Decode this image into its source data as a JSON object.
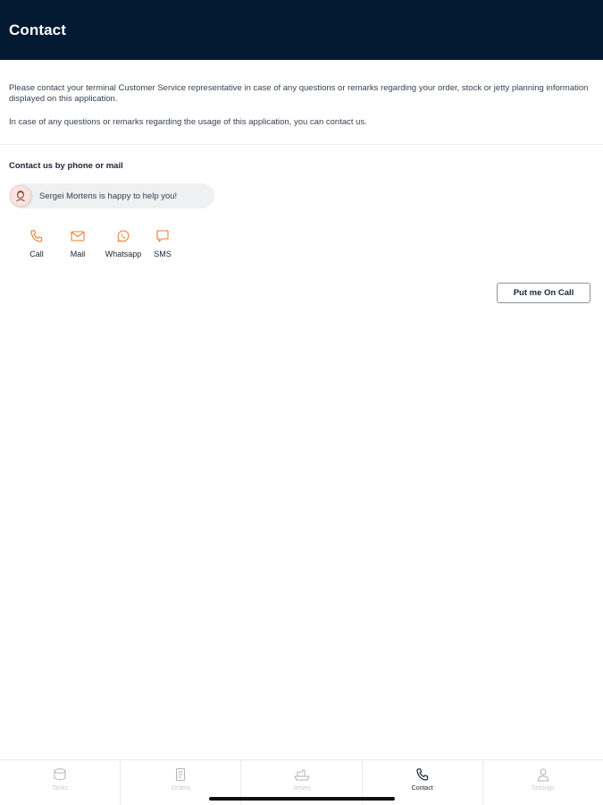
{
  "header": {
    "title": "Contact"
  },
  "intro": {
    "paragraph1": "Please contact your terminal Customer Service representative in case of any questions or remarks regarding your order, stock or jetty planning information displayed on this application.",
    "paragraph2": "In case of any questions or remarks regarding the usage of this application, you can contact us."
  },
  "contact": {
    "section_title": "Contact us by phone or mail",
    "agent_message": "Sergei Mortens is happy to help you!",
    "actions": [
      {
        "label": "Call",
        "icon": "phone-icon"
      },
      {
        "label": "Mail",
        "icon": "mail-icon"
      },
      {
        "label": "Whatsapp",
        "icon": "whatsapp-icon"
      },
      {
        "label": "SMS",
        "icon": "sms-icon"
      }
    ],
    "on_call_button": "Put me On Call"
  },
  "tabbar": {
    "tabs": [
      {
        "label": "Tanks",
        "icon": "tank-icon",
        "active": false
      },
      {
        "label": "Orders",
        "icon": "document-icon",
        "active": false
      },
      {
        "label": "Jetties",
        "icon": "ship-icon",
        "active": false
      },
      {
        "label": "Contact",
        "icon": "phone-icon",
        "active": true
      },
      {
        "label": "Settings",
        "icon": "user-icon",
        "active": false
      }
    ]
  },
  "colors": {
    "header_bg": "#041a33",
    "accent": "#f07a2e",
    "pill_bg": "#eef0f2"
  }
}
